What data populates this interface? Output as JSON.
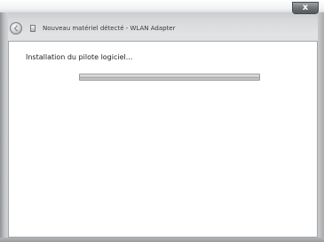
{
  "window": {
    "title": "Nouveau matériel détecté - WLAN Adapter",
    "close_glyph": "x"
  },
  "icons": {
    "back": "back-arrow-icon",
    "device": "hardware-device-icon",
    "close": "close-icon"
  },
  "main": {
    "status_text": "Installation du pilote logiciel...",
    "progress_fraction": 1.0
  },
  "colors": {
    "content_background": "#ffffff",
    "progress_fill": "#c2c2c2"
  }
}
